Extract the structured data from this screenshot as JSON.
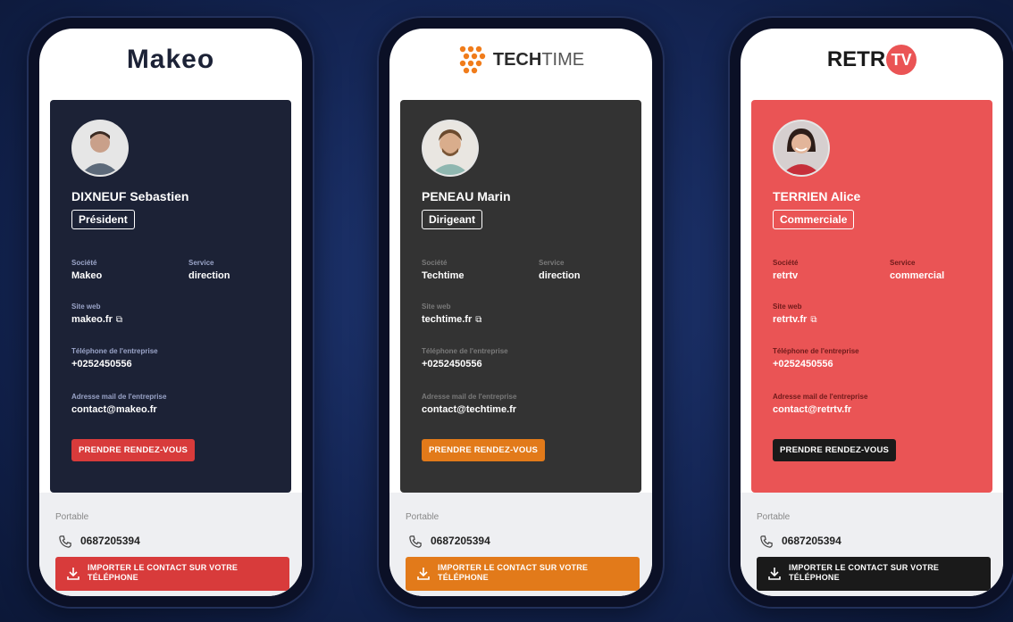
{
  "cards": [
    {
      "logo": {
        "text": "Makeo"
      },
      "name": "DIXNEUF Sebastien",
      "role": "Président",
      "societe_label": "Société",
      "societe": "Makeo",
      "service_label": "Service",
      "service": "direction",
      "site_label": "Site web",
      "site": "makeo.fr",
      "tel_label": "Téléphone de l'entreprise",
      "tel": "+0252450556",
      "mail_label": "Adresse mail de l'entreprise",
      "mail": "contact@makeo.fr",
      "cta": "PRENDRE RENDEZ-VOUS",
      "portable_label": "Portable",
      "portable": "0687205394",
      "import": "IMPORTER LE CONTACT SUR VOTRE TÉLÉPHONE",
      "colors": {
        "card": "#1c2236",
        "accent": "#d83b3b",
        "label": "#9aa4c8"
      }
    },
    {
      "logo": {
        "text_bold": "TECH",
        "text_light": "TIME"
      },
      "name": "PENEAU Marin",
      "role": "Dirigeant",
      "societe_label": "Société",
      "societe": "Techtime",
      "service_label": "Service",
      "service": "direction",
      "site_label": "Site web",
      "site": "techtime.fr",
      "tel_label": "Téléphone de l'entreprise",
      "tel": "+0252450556",
      "mail_label": "Adresse mail de l'entreprise",
      "mail": "contact@techtime.fr",
      "cta": "PRENDRE RENDEZ-VOUS",
      "portable_label": "Portable",
      "portable": "0687205394",
      "import": "IMPORTER LE CONTACT SUR VOTRE TÉLÉPHONE",
      "colors": {
        "card": "#333333",
        "accent": "#e27a1a",
        "label": "#7a7a7a"
      }
    },
    {
      "logo": {
        "text": "RETR",
        "badge": "TV"
      },
      "name": "TERRIEN Alice",
      "role": "Commerciale",
      "societe_label": "Société",
      "societe": "retrtv",
      "service_label": "Service",
      "service": "commercial",
      "site_label": "Site web",
      "site": "retrtv.fr",
      "tel_label": "Téléphone de l'entreprise",
      "tel": "+0252450556",
      "mail_label": "Adresse mail de l'entreprise",
      "mail": "contact@retrtv.fr",
      "cta": "PRENDRE RENDEZ-VOUS",
      "portable_label": "Portable",
      "portable": "0687205394",
      "import": "IMPORTER LE CONTACT SUR VOTRE TÉLÉPHONE",
      "colors": {
        "card": "#ea5455",
        "accent": "#1a1a1a",
        "label": "#6e1a1a"
      }
    }
  ]
}
